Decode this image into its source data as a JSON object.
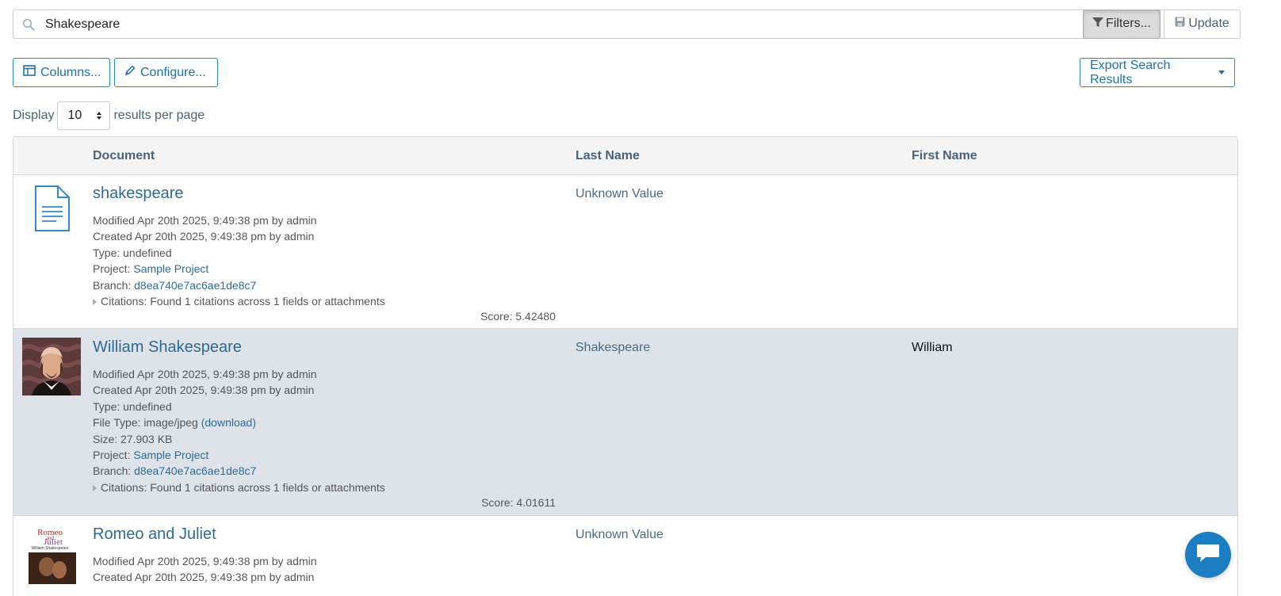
{
  "search": {
    "value": "Shakespeare",
    "filters_label": "Filters...",
    "update_label": "Update"
  },
  "toolbar": {
    "columns_label": "Columns...",
    "configure_label": "Configure...",
    "export_label": "Export Search Results"
  },
  "display": {
    "prefix": "Display",
    "per_page": "10",
    "suffix": "results per page"
  },
  "table": {
    "headers": {
      "document": "Document",
      "last_name": "Last Name",
      "first_name": "First Name"
    },
    "rows": [
      {
        "title": "shakespeare",
        "modified": "Modified Apr 20th 2025, 9:49:38 pm by admin",
        "created": "Created Apr 20th 2025, 9:49:38 pm by admin",
        "type": "Type: undefined",
        "project_label": "Project: ",
        "project": "Sample Project",
        "branch_label": "Branch: ",
        "branch": "d8ea740e7ac6ae1de8c7",
        "citations": "Citations: Found 1 citations across 1 fields or attachments",
        "score": "Score: 5.42480",
        "last_name": "Unknown Value",
        "first_name": ""
      },
      {
        "title": "William Shakespeare",
        "modified": "Modified Apr 20th 2025, 9:49:38 pm by admin",
        "created": "Created Apr 20th 2025, 9:49:38 pm by admin",
        "type": "Type: undefined",
        "file_type_label": "File Type: image/jpeg ",
        "download": "(download)",
        "size": "Size: 27.903 KB",
        "project_label": "Project: ",
        "project": "Sample Project",
        "branch_label": "Branch: ",
        "branch": "d8ea740e7ac6ae1de8c7",
        "citations": "Citations: Found 1 citations across 1 fields or attachments",
        "score": "Score: 4.01611",
        "last_name": "Shakespeare",
        "first_name": "William"
      },
      {
        "title": "Romeo and Juliet",
        "modified": "Modified Apr 20th 2025, 9:49:38 pm by admin",
        "created": "Created Apr 20th 2025, 9:49:38 pm by admin",
        "last_name": "Unknown Value",
        "thumb_text": {
          "line1": "Romeo",
          "line2": "and",
          "line3": "Juliet",
          "line4": "William Shakespeare"
        }
      }
    ]
  },
  "colors": {
    "accent": "#2e86c1",
    "link": "#2e6a93",
    "selected_row": "#dde3e8",
    "chat": "#1b7ec2"
  },
  "icons": [
    "search-icon",
    "filter-icon",
    "save-icon",
    "columns-icon",
    "pencil-icon",
    "document-icon",
    "chat-icon"
  ]
}
